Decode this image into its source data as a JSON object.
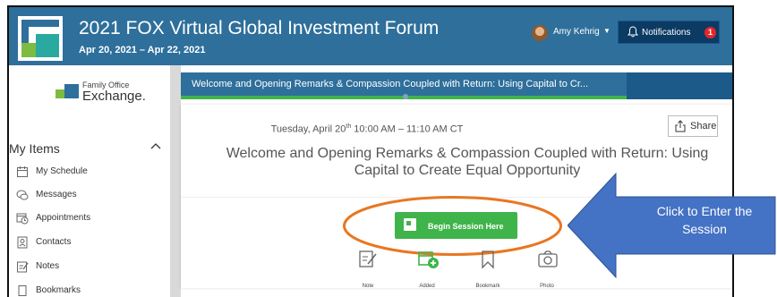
{
  "header": {
    "title": "2021 FOX Virtual Global Investment Forum",
    "dates": "Apr 20, 2021 – Apr 22, 2021",
    "user_name": "Amy Kehrig",
    "notifications_label": "Notifications",
    "notifications_count": "1"
  },
  "sidebar": {
    "logo_line1": "Family Office",
    "logo_line2": "Exchange.",
    "section_title": "My Items",
    "items": [
      {
        "label": "My Schedule",
        "icon": "calendar-icon"
      },
      {
        "label": "Messages",
        "icon": "chat-icon"
      },
      {
        "label": "Appointments",
        "icon": "calendar-clock-icon"
      },
      {
        "label": "Contacts",
        "icon": "contact-card-icon"
      },
      {
        "label": "Notes",
        "icon": "note-icon"
      },
      {
        "label": "Bookmarks",
        "icon": "bookmark-icon"
      }
    ]
  },
  "session": {
    "tab_label": "Welcome and Opening Remarks & Compassion Coupled with Return: Using Capital to Cr...",
    "datetime_prefix": "Tuesday, April 20",
    "datetime_sup": "th",
    "datetime_suffix": " 10:00 AM – 11:10 AM CT",
    "title": "Welcome and Opening Remarks & Compassion Coupled with Return: Using Capital to Create Equal Opportunity",
    "share_label": "Share",
    "begin_label": "Begin Session Here",
    "actions": [
      {
        "label": "Note",
        "icon": "note-edit-icon"
      },
      {
        "label": "Added",
        "icon": "added-calendar-icon"
      },
      {
        "label": "Bookmark",
        "icon": "bookmark-icon"
      },
      {
        "label": "Photo",
        "icon": "camera-icon"
      }
    ]
  },
  "annotation": {
    "callout_text": "Click to Enter the Session",
    "arrow_color": "#4472c4",
    "highlight_color": "#e87722"
  },
  "colors": {
    "header": "#2e6f9b",
    "tab_bar": "#1c5a8a",
    "accent_green": "#3fb44a",
    "badge_red": "#e3262b"
  }
}
